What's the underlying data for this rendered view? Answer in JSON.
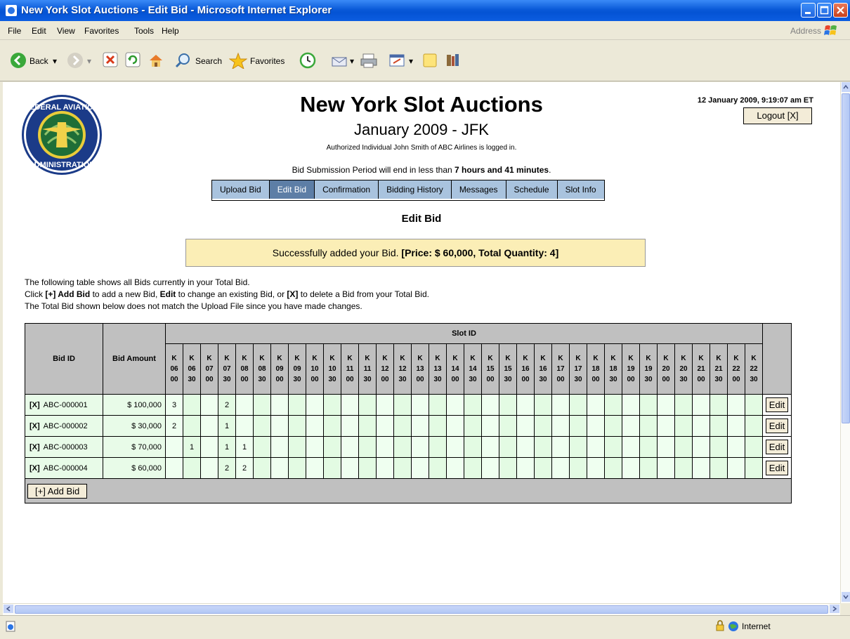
{
  "window": {
    "title": "New York Slot Auctions - Edit Bid - Microsoft Internet Explorer"
  },
  "menu": {
    "items": [
      "File",
      "Edit",
      "View",
      "Favorites",
      "Tools",
      "Help"
    ],
    "address_label": "Address"
  },
  "toolbar": {
    "back": "Back",
    "search": "Search",
    "favorites": "Favorites"
  },
  "header": {
    "title": "New York Slot Auctions",
    "subtitle": "January 2009 - JFK",
    "logged_in": "Authorized Individual John Smith of ABC Airlines is logged in.",
    "datetime": "12 January 2009, 9:19:07 am ET",
    "logout": "Logout [X]",
    "period_prefix": "Bid Submission Period will end in less than ",
    "period_bold": "7 hours and 41 minutes",
    "period_suffix": "."
  },
  "nav": {
    "tabs": [
      "Upload Bid",
      "Edit Bid",
      "Confirmation",
      "Bidding History",
      "Messages",
      "Schedule",
      "Slot Info"
    ],
    "active": "Edit Bid"
  },
  "page": {
    "heading": "Edit Bid",
    "success_text": "Successfully added your Bid. ",
    "success_bold": "[Price: $ 60,000, Total Quantity: 4]",
    "info_line1": "The following table shows all Bids currently in your Total Bid.",
    "info_line2_parts": [
      "Click ",
      "[+] Add Bid",
      " to add a new Bid, ",
      "Edit",
      " to change an existing Bid, or ",
      "[X]",
      " to delete a Bid from your Total Bid."
    ],
    "info_line3": "The Total Bid shown below does not match the Upload File since you have made changes."
  },
  "table": {
    "col_bid_id": "Bid ID",
    "col_bid_amount": "Bid Amount",
    "col_slot_id": "Slot ID",
    "slots": [
      [
        "K",
        "06",
        "00"
      ],
      [
        "K",
        "06",
        "30"
      ],
      [
        "K",
        "07",
        "00"
      ],
      [
        "K",
        "07",
        "30"
      ],
      [
        "K",
        "08",
        "00"
      ],
      [
        "K",
        "08",
        "30"
      ],
      [
        "K",
        "09",
        "00"
      ],
      [
        "K",
        "09",
        "30"
      ],
      [
        "K",
        "10",
        "00"
      ],
      [
        "K",
        "10",
        "30"
      ],
      [
        "K",
        "11",
        "00"
      ],
      [
        "K",
        "11",
        "30"
      ],
      [
        "K",
        "12",
        "00"
      ],
      [
        "K",
        "12",
        "30"
      ],
      [
        "K",
        "13",
        "00"
      ],
      [
        "K",
        "13",
        "30"
      ],
      [
        "K",
        "14",
        "00"
      ],
      [
        "K",
        "14",
        "30"
      ],
      [
        "K",
        "15",
        "00"
      ],
      [
        "K",
        "15",
        "30"
      ],
      [
        "K",
        "16",
        "00"
      ],
      [
        "K",
        "16",
        "30"
      ],
      [
        "K",
        "17",
        "00"
      ],
      [
        "K",
        "17",
        "30"
      ],
      [
        "K",
        "18",
        "00"
      ],
      [
        "K",
        "18",
        "30"
      ],
      [
        "K",
        "19",
        "00"
      ],
      [
        "K",
        "19",
        "30"
      ],
      [
        "K",
        "20",
        "00"
      ],
      [
        "K",
        "20",
        "30"
      ],
      [
        "K",
        "21",
        "00"
      ],
      [
        "K",
        "21",
        "30"
      ],
      [
        "K",
        "22",
        "00"
      ],
      [
        "K",
        "22",
        "30"
      ]
    ],
    "rows": [
      {
        "delete": "[X]",
        "id": "ABC-000001",
        "amount": "$ 100,000",
        "values": [
          "3",
          "",
          "",
          "2",
          "",
          "",
          "",
          "",
          "",
          "",
          "",
          "",
          "",
          "",
          "",
          "",
          "",
          "",
          "",
          "",
          "",
          "",
          "",
          "",
          "",
          "",
          "",
          "",
          "",
          "",
          "",
          "",
          "",
          ""
        ],
        "edit": "Edit"
      },
      {
        "delete": "[X]",
        "id": "ABC-000002",
        "amount": "$ 30,000",
        "values": [
          "2",
          "",
          "",
          "1",
          "",
          "",
          "",
          "",
          "",
          "",
          "",
          "",
          "",
          "",
          "",
          "",
          "",
          "",
          "",
          "",
          "",
          "",
          "",
          "",
          "",
          "",
          "",
          "",
          "",
          "",
          "",
          "",
          "",
          ""
        ],
        "edit": "Edit"
      },
      {
        "delete": "[X]",
        "id": "ABC-000003",
        "amount": "$ 70,000",
        "values": [
          "",
          "1",
          "",
          "1",
          "1",
          "",
          "",
          "",
          "",
          "",
          "",
          "",
          "",
          "",
          "",
          "",
          "",
          "",
          "",
          "",
          "",
          "",
          "",
          "",
          "",
          "",
          "",
          "",
          "",
          "",
          "",
          "",
          "",
          ""
        ],
        "edit": "Edit"
      },
      {
        "delete": "[X]",
        "id": "ABC-000004",
        "amount": "$ 60,000",
        "values": [
          "",
          "",
          "",
          "2",
          "2",
          "",
          "",
          "",
          "",
          "",
          "",
          "",
          "",
          "",
          "",
          "",
          "",
          "",
          "",
          "",
          "",
          "",
          "",
          "",
          "",
          "",
          "",
          "",
          "",
          "",
          "",
          "",
          "",
          ""
        ],
        "edit": "Edit"
      }
    ],
    "add_bid": "[+] Add Bid"
  },
  "status": {
    "zone": "Internet"
  }
}
